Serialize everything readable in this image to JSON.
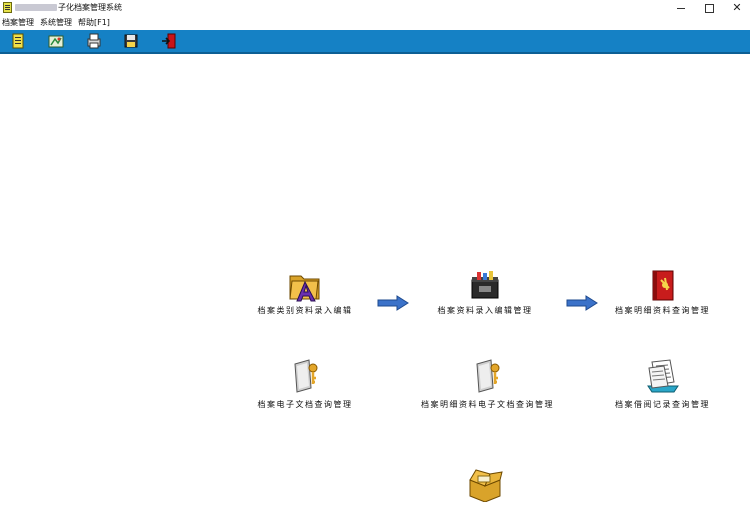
{
  "window": {
    "title": "子化档案管理系统",
    "title_obscured_prefix": true
  },
  "menubar": {
    "items": [
      "档案管理",
      "系统管理",
      "帮助[F1]"
    ]
  },
  "toolbar": {
    "buttons": [
      "notebook-icon",
      "map-icon",
      "printer-icon",
      "save-disk-icon",
      "exit-door-icon"
    ]
  },
  "modules": [
    {
      "label": "档案类别资料录入编辑",
      "icon": "folder-a-icon"
    },
    {
      "label": "档案资料录入编辑管理",
      "icon": "toolbox-icon"
    },
    {
      "label": "档案明细资料查询管理",
      "icon": "red-book-icon"
    },
    {
      "label": "档案电子文档查询管理",
      "icon": "key-document-icon"
    },
    {
      "label": "档案明细资料电子文档查询管理",
      "icon": "key-document-icon"
    },
    {
      "label": "档案借阅记录查询管理",
      "icon": "document-stack-icon"
    },
    {
      "label": "",
      "icon": "open-box-icon"
    }
  ],
  "colors": {
    "toolbar": "#1581c5",
    "arrow": "#3b72c9"
  }
}
